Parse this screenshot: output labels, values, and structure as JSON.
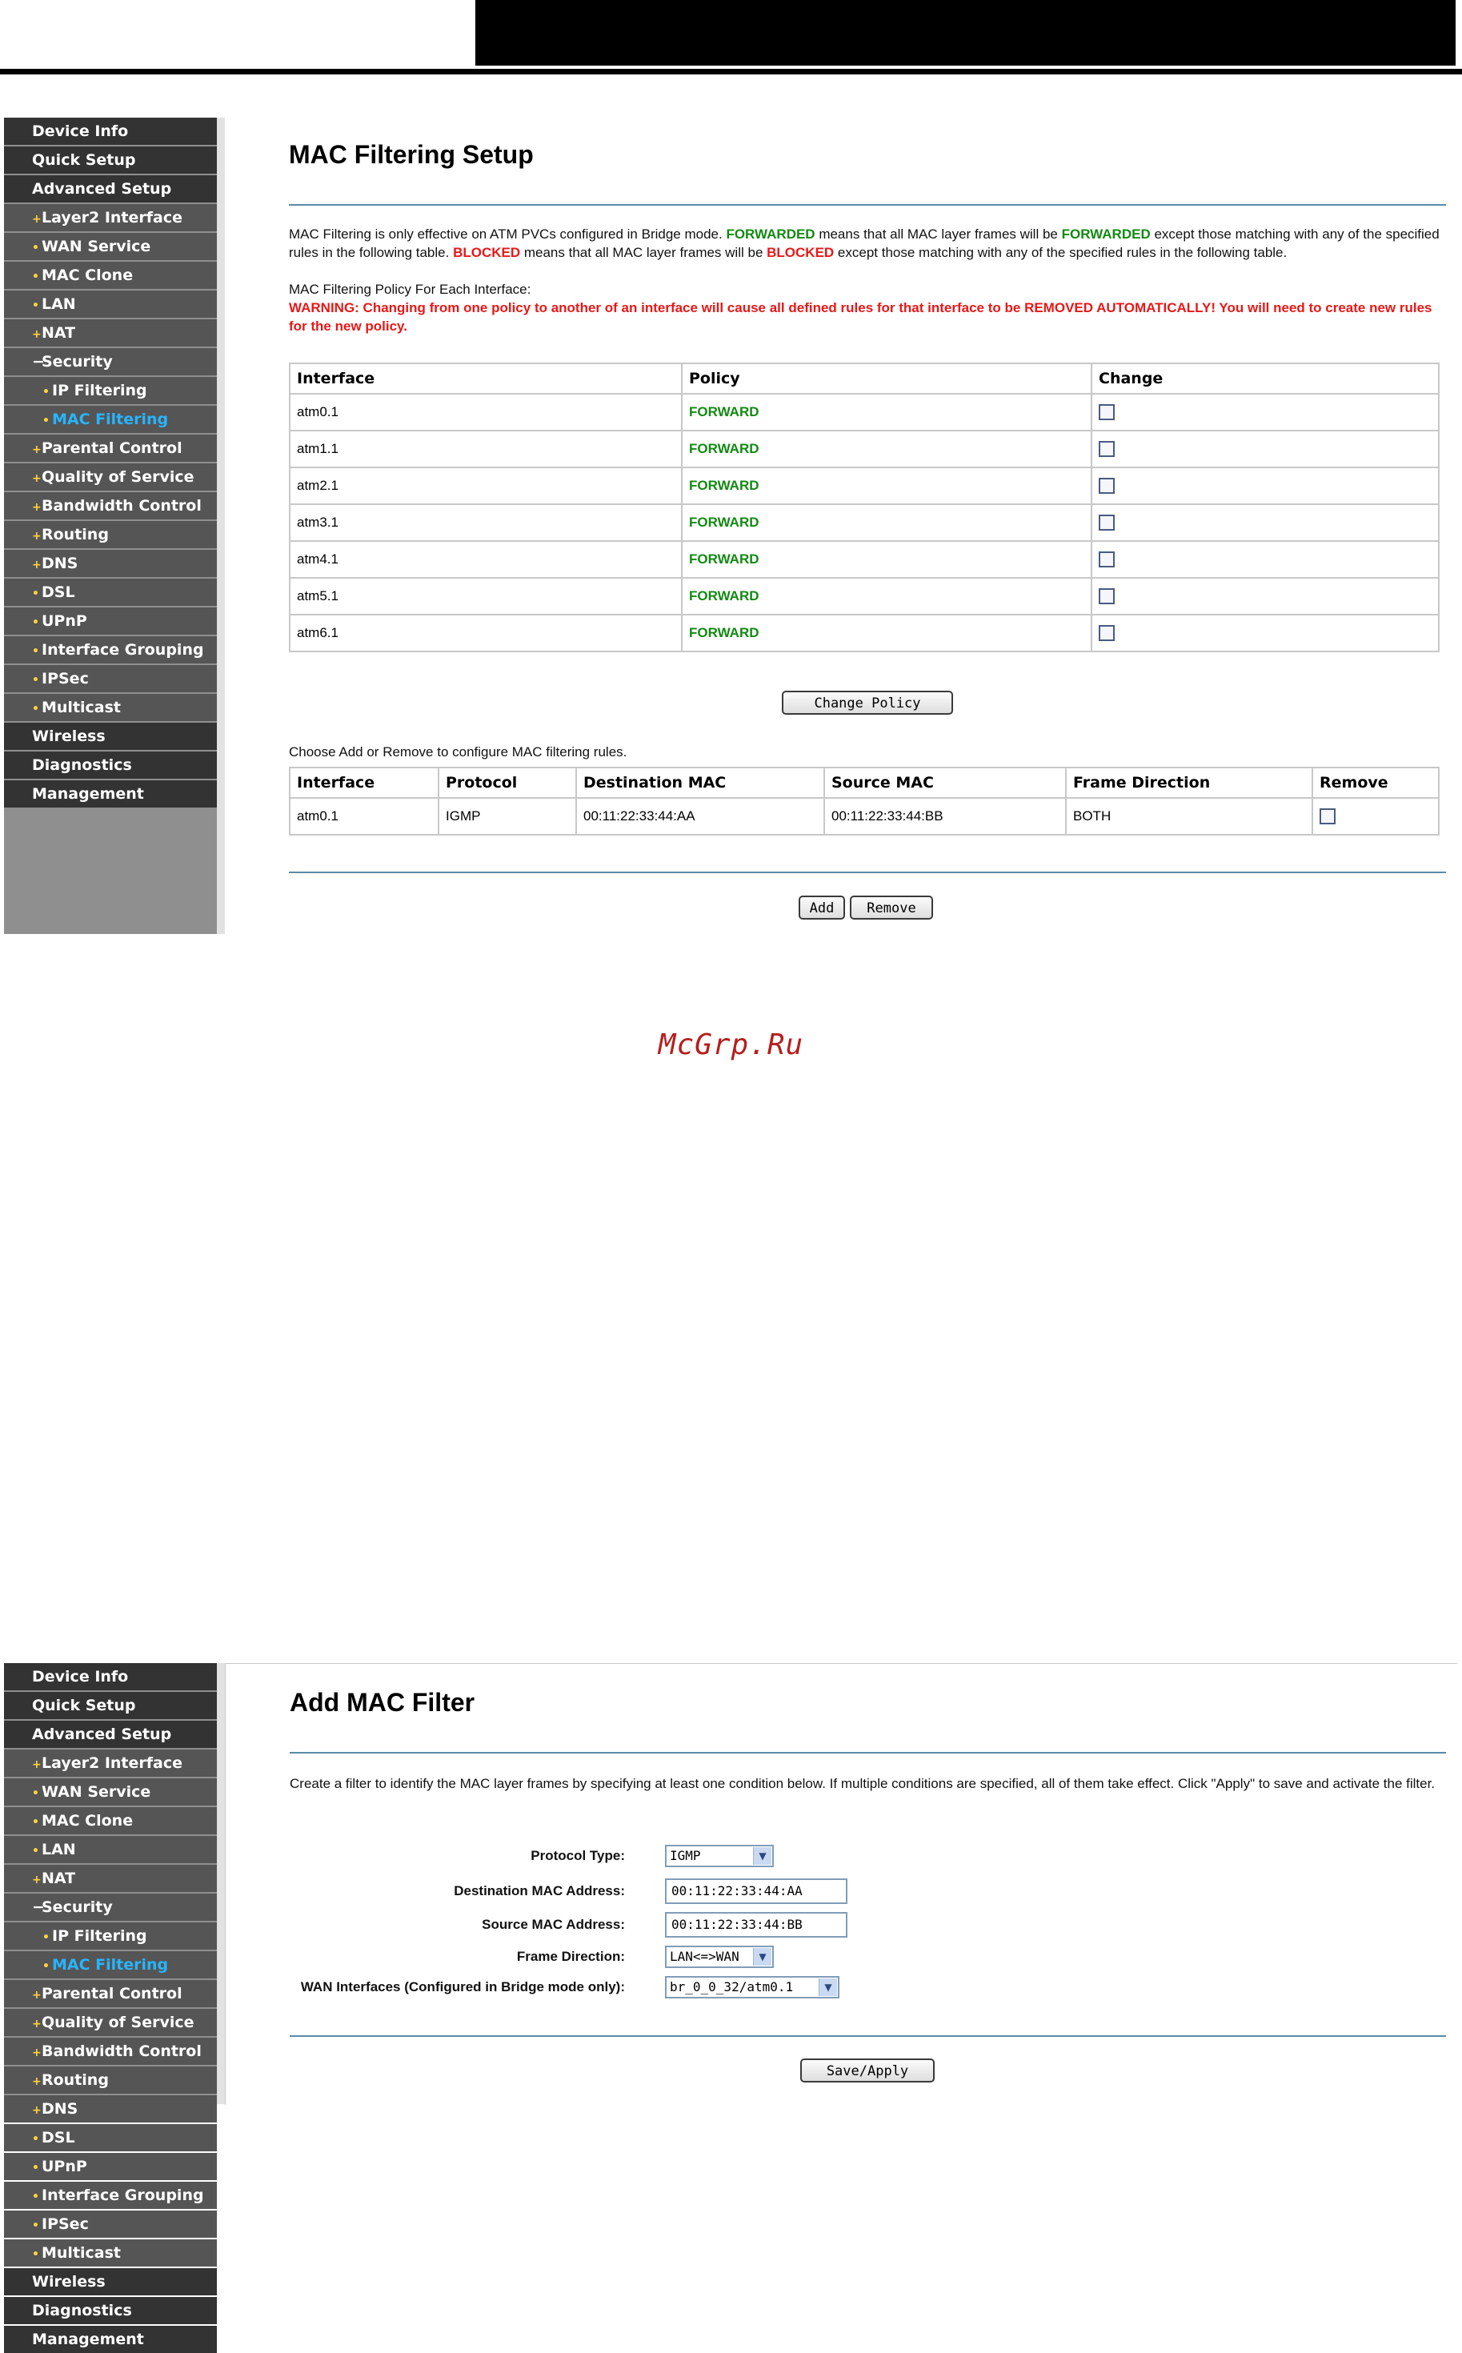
{
  "watermark": "McGrp.Ru",
  "nav": [
    {
      "label": "Device Info",
      "level": "top",
      "prefix": "none"
    },
    {
      "label": "Quick Setup",
      "level": "top",
      "prefix": "none"
    },
    {
      "label": "Advanced Setup",
      "level": "top",
      "prefix": "none"
    },
    {
      "label": "Layer2 Interface",
      "level": "sub1",
      "prefix": "plus"
    },
    {
      "label": "WAN Service",
      "level": "sub1",
      "prefix": "dot"
    },
    {
      "label": "MAC Clone",
      "level": "sub1",
      "prefix": "dot"
    },
    {
      "label": "LAN",
      "level": "sub1",
      "prefix": "dot"
    },
    {
      "label": "NAT",
      "level": "sub1",
      "prefix": "plus"
    },
    {
      "label": "Security",
      "level": "sub1",
      "prefix": "minus"
    },
    {
      "label": "IP Filtering",
      "level": "sub2",
      "prefix": "dot"
    },
    {
      "label": "MAC Filtering",
      "level": "sub2",
      "prefix": "dot",
      "active": true
    },
    {
      "label": "Parental Control",
      "level": "sub1",
      "prefix": "plus"
    },
    {
      "label": "Quality of Service",
      "level": "sub1",
      "prefix": "plus"
    },
    {
      "label": "Bandwidth Control",
      "level": "sub1",
      "prefix": "plus"
    },
    {
      "label": "Routing",
      "level": "sub1",
      "prefix": "plus"
    },
    {
      "label": "DNS",
      "level": "sub1",
      "prefix": "plus"
    },
    {
      "label": "DSL",
      "level": "sub1",
      "prefix": "dot"
    },
    {
      "label": "UPnP",
      "level": "sub1",
      "prefix": "dot"
    },
    {
      "label": "Interface Grouping",
      "level": "sub1",
      "prefix": "dot"
    },
    {
      "label": "IPSec",
      "level": "sub1",
      "prefix": "dot"
    },
    {
      "label": "Multicast",
      "level": "sub1",
      "prefix": "dot"
    },
    {
      "label": "Wireless",
      "level": "top",
      "prefix": "none"
    },
    {
      "label": "Diagnostics",
      "level": "top",
      "prefix": "none"
    },
    {
      "label": "Management",
      "level": "top",
      "prefix": "none"
    }
  ],
  "panel1": {
    "title": "MAC Filtering Setup",
    "intro": {
      "p1": "MAC Filtering is only effective on ATM PVCs configured in Bridge mode. ",
      "fw1": "FORWARDED",
      "p2": " means that all MAC layer frames will be ",
      "fw2": "FORWARDED",
      "p3": " except those matching with any of the specified rules in the following table. ",
      "bl1": "BLOCKED",
      "p4": " means that all MAC layer frames will be ",
      "bl2": "BLOCKED",
      "p5": " except those matching with any of the specified rules in the following table."
    },
    "policy_heading": "MAC Filtering Policy For Each Interface:",
    "warning": "WARNING: Changing from one policy to another of an interface will cause all defined rules for that interface to be REMOVED AUTOMATICALLY! You will need to create new rules for the new policy.",
    "policy_table": {
      "headers": [
        "Interface",
        "Policy",
        "Change"
      ],
      "rows": [
        {
          "interface": "atm0.1",
          "policy": "FORWARD"
        },
        {
          "interface": "atm1.1",
          "policy": "FORWARD"
        },
        {
          "interface": "atm2.1",
          "policy": "FORWARD"
        },
        {
          "interface": "atm3.1",
          "policy": "FORWARD"
        },
        {
          "interface": "atm4.1",
          "policy": "FORWARD"
        },
        {
          "interface": "atm5.1",
          "policy": "FORWARD"
        },
        {
          "interface": "atm6.1",
          "policy": "FORWARD"
        }
      ]
    },
    "change_policy_button": "Change Policy",
    "rules_heading": "Choose Add or Remove to configure MAC filtering rules.",
    "rules_table": {
      "headers": [
        "Interface",
        "Protocol",
        "Destination MAC",
        "Source MAC",
        "Frame Direction",
        "Remove"
      ],
      "rows": [
        {
          "interface": "atm0.1",
          "protocol": "IGMP",
          "dest": "00:11:22:33:44:AA",
          "src": "00:11:22:33:44:BB",
          "direction": "BOTH"
        }
      ]
    },
    "add_button": "Add",
    "remove_button": "Remove"
  },
  "panel2": {
    "title": "Add MAC Filter",
    "intro": "Create a filter to identify the MAC layer frames by specifying at least one condition below. If multiple conditions are specified, all of them take effect. Click \"Apply\" to save and activate the filter.",
    "fields": {
      "protocol_label": "Protocol Type:",
      "protocol_value": "IGMP",
      "dest_label": "Destination MAC Address:",
      "dest_value": "00:11:22:33:44:AA",
      "src_label": "Source MAC Address:",
      "src_value": "00:11:22:33:44:BB",
      "direction_label": "Frame Direction:",
      "direction_value": "LAN<=>WAN",
      "wan_label": "WAN Interfaces (Configured in Bridge mode only):",
      "wan_value": "br_0_0_32/atm0.1"
    },
    "save_button": "Save/Apply"
  }
}
